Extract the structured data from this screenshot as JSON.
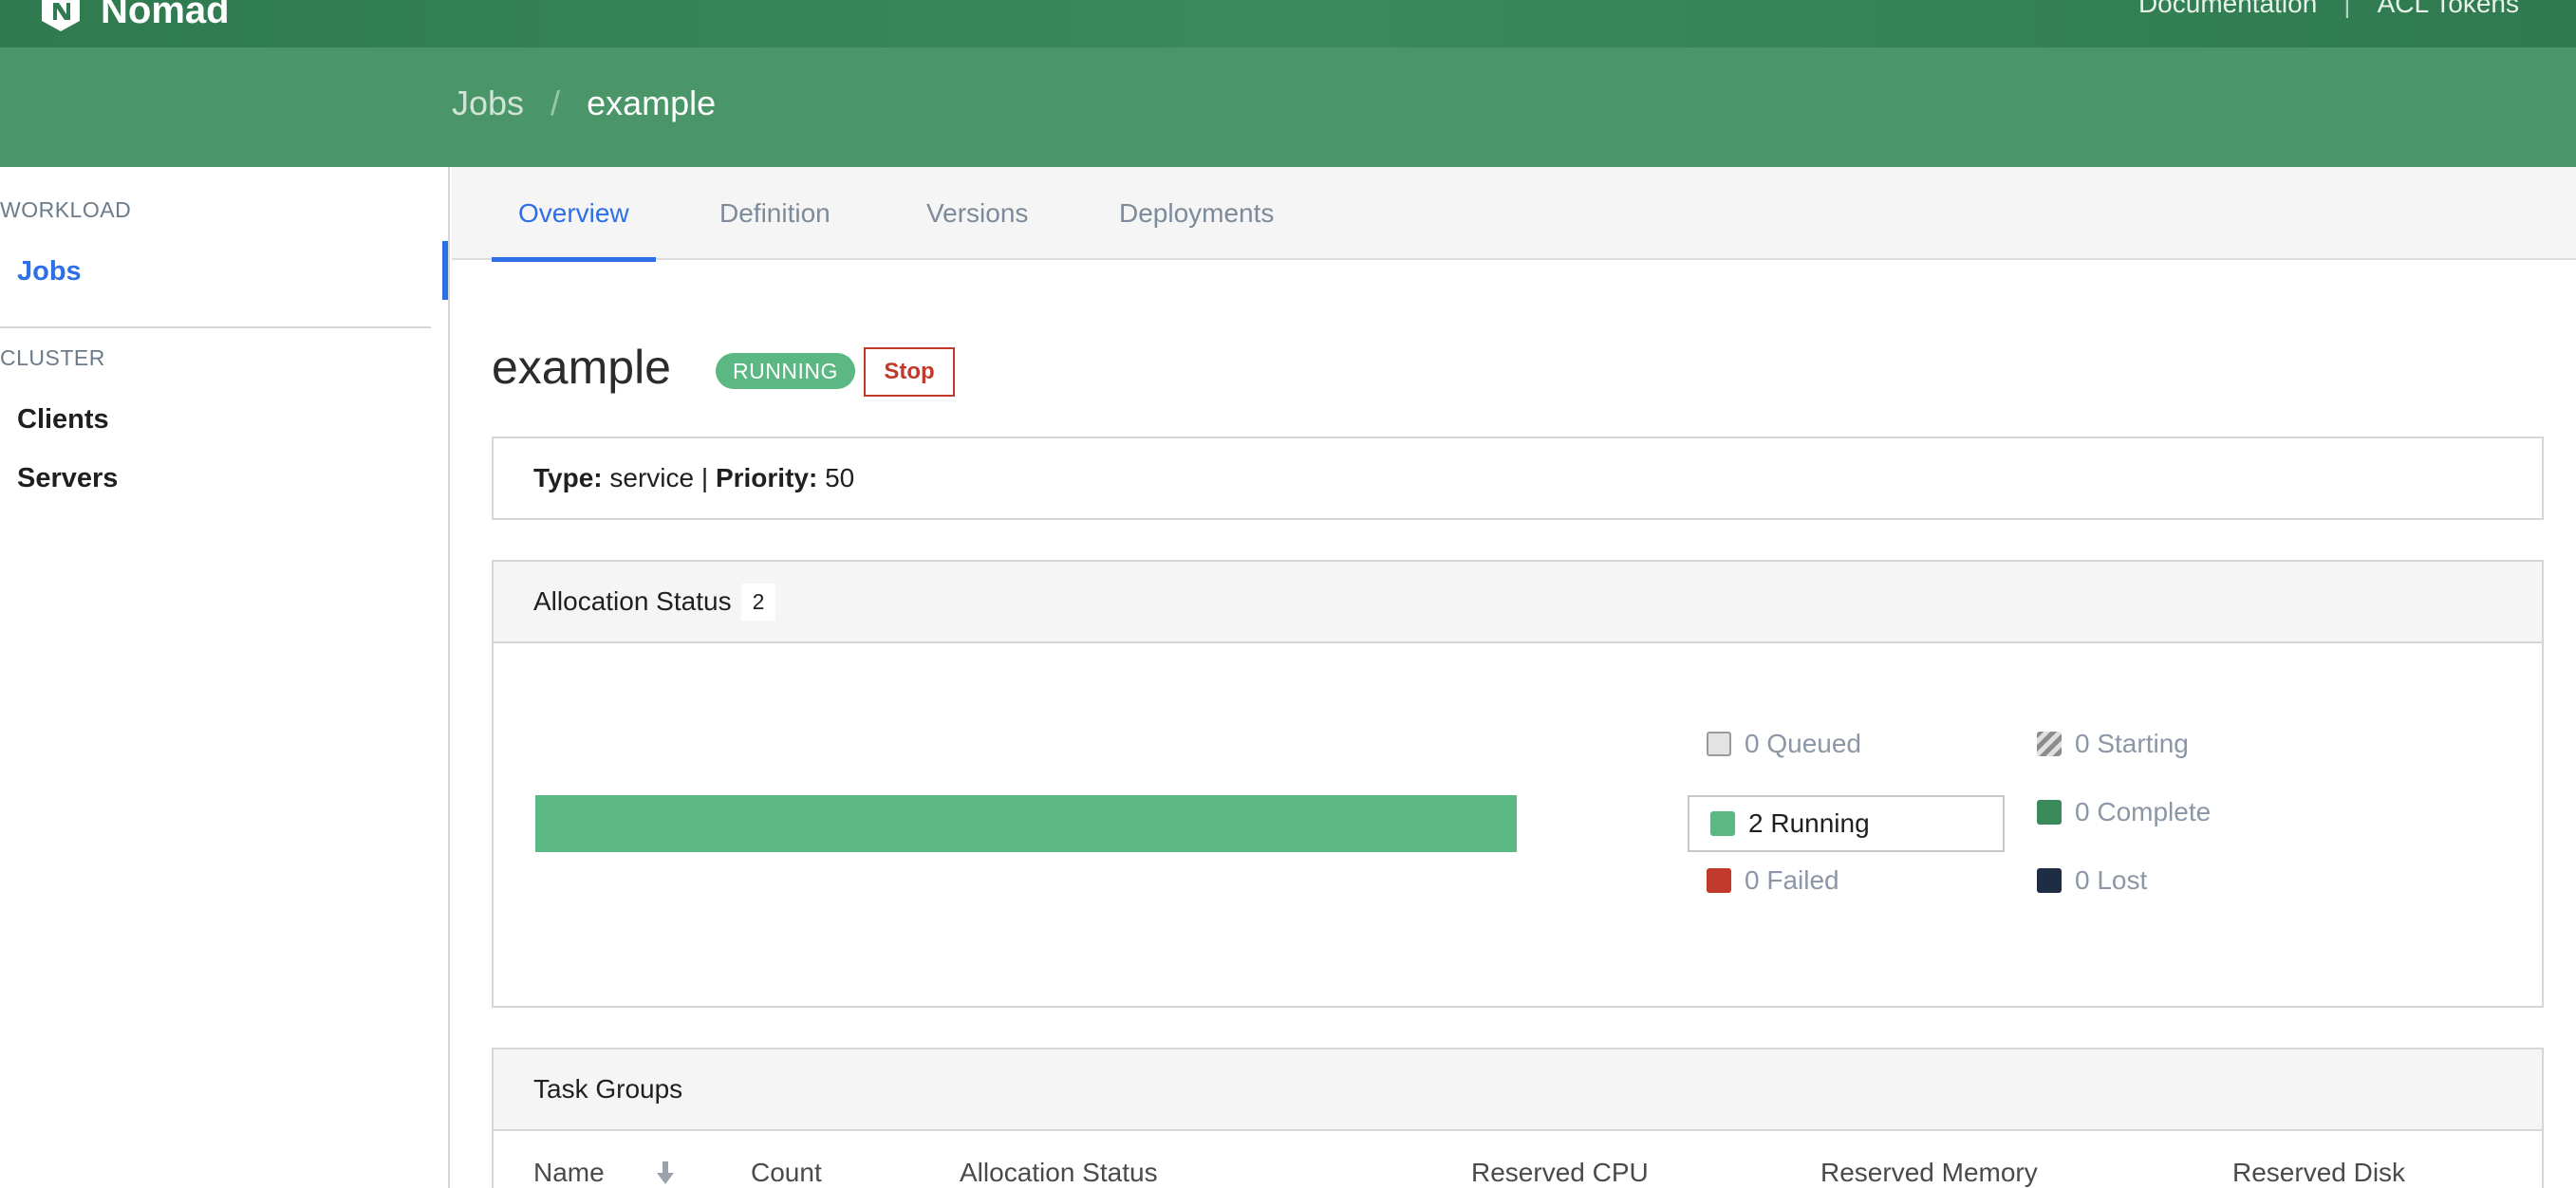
{
  "app": {
    "brand": "Nomad",
    "top_links": [
      "Documentation",
      "ACL Tokens"
    ],
    "top_separator": "|"
  },
  "breadcrumb": {
    "root": "Jobs",
    "separator": "/",
    "current": "example"
  },
  "sidebar": {
    "sections": [
      {
        "heading": "WORKLOAD",
        "items": [
          {
            "label": "Jobs",
            "active": true
          }
        ]
      },
      {
        "heading": "CLUSTER",
        "items": [
          {
            "label": "Clients",
            "active": false
          },
          {
            "label": "Servers",
            "active": false
          }
        ]
      }
    ]
  },
  "tabs": [
    {
      "label": "Overview",
      "active": true
    },
    {
      "label": "Definition",
      "active": false
    },
    {
      "label": "Versions",
      "active": false
    },
    {
      "label": "Deployments",
      "active": false
    }
  ],
  "job": {
    "name": "example",
    "status": "RUNNING",
    "stop_label": "Stop",
    "type_label": "Type:",
    "type": "service",
    "meta_separator": "|",
    "priority_label": "Priority:",
    "priority": "50"
  },
  "allocation_status": {
    "title": "Allocation Status",
    "total": "2",
    "running_fraction": 1.0,
    "legend": [
      {
        "key": "queued",
        "text": "0 Queued",
        "active": false
      },
      {
        "key": "starting",
        "text": "0 Starting",
        "active": false
      },
      {
        "key": "running",
        "text": "2 Running",
        "active": true
      },
      {
        "key": "complete",
        "text": "0 Complete",
        "active": false
      },
      {
        "key": "failed",
        "text": "0 Failed",
        "active": false
      },
      {
        "key": "lost",
        "text": "0 Lost",
        "active": false
      }
    ]
  },
  "task_groups": {
    "title": "Task Groups",
    "columns": [
      "Name",
      "Count",
      "Allocation Status",
      "Reserved CPU",
      "Reserved Memory",
      "Reserved Disk"
    ]
  },
  "colors": {
    "brand_green": "#3a8a5c",
    "accent_blue": "#2d6fe6",
    "running_green": "#5bb882",
    "danger_red": "#c0392b",
    "lost_navy": "#1f2d44"
  }
}
